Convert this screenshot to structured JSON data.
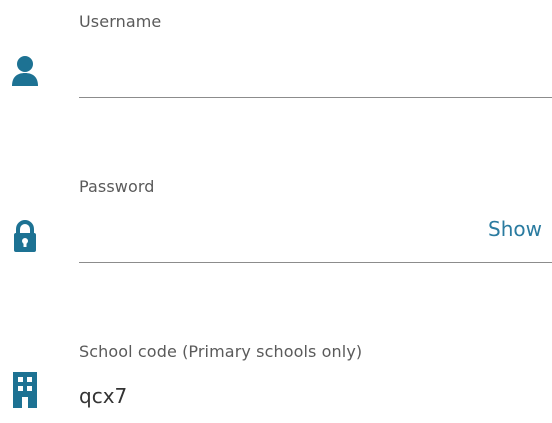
{
  "form": {
    "username": {
      "label": "Username",
      "value": "",
      "icon": "user-icon"
    },
    "password": {
      "label": "Password",
      "value": "",
      "icon": "lock-icon",
      "toggle_label": "Show"
    },
    "school_code": {
      "label": "School code (Primary schools only)",
      "value": "qcx7",
      "icon": "building-icon"
    }
  },
  "colors": {
    "icon": "#1d7293",
    "link": "#2a7ba0",
    "underline": "#8c8c8c",
    "label": "#5a5a5a"
  }
}
